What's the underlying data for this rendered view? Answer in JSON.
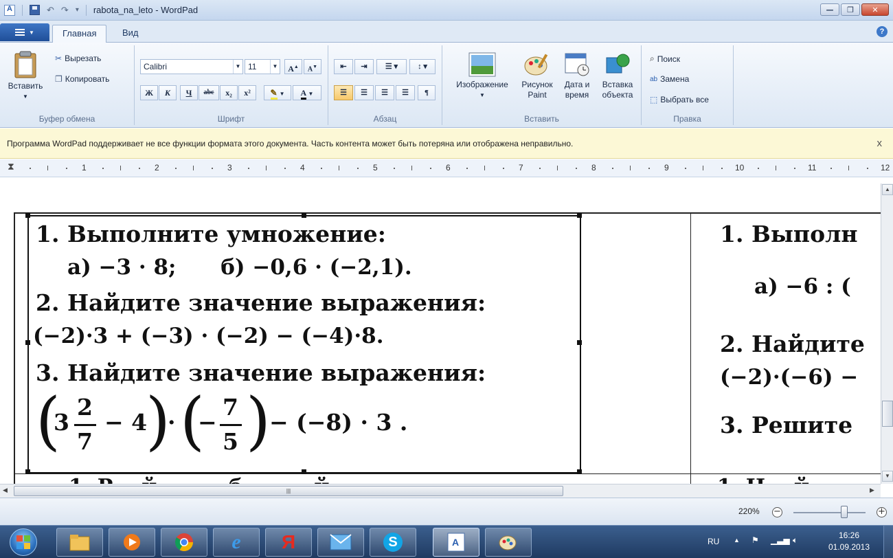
{
  "window": {
    "title": "rabota_na_leto - WordPad",
    "controls": {
      "minimize": "—",
      "maximize": "❐",
      "close": "✕"
    }
  },
  "ribbon": {
    "tabs": [
      {
        "label": "Главная",
        "active": true
      },
      {
        "label": "Вид",
        "active": false
      }
    ],
    "clipboard": {
      "paste": "Вставить",
      "cut": "Вырезать",
      "copy": "Копировать",
      "label": "Буфер обмена"
    },
    "font": {
      "family": "Calibri",
      "size": "11",
      "grow": "A",
      "shrink": "A",
      "bold": "Ж",
      "italic": "К",
      "underline": "Ч",
      "strike": "abc",
      "subscript": "x₂",
      "superscript": "x²",
      "highlight": "✎",
      "color": "A",
      "label": "Шрифт"
    },
    "paragraph": {
      "label": "Абзац"
    },
    "insert": {
      "picture": "Изображение",
      "paint": [
        "Рисунок",
        "Paint"
      ],
      "datetime": [
        "Дата и",
        "время"
      ],
      "object": [
        "Вставка",
        "объекта"
      ],
      "label": "Вставить"
    },
    "editing": {
      "find": "Поиск",
      "replace": "Замена",
      "select_all": "Выбрать все",
      "label": "Правка"
    }
  },
  "infobar": {
    "message": "Программа WordPad поддерживает не все функции формата этого документа. Часть контента может быть потеряна или отображена неправильно.",
    "close": "x"
  },
  "ruler": {
    "numbers": [
      "1",
      "2",
      "3",
      "4",
      "5",
      "6",
      "7",
      "8",
      "9",
      "10",
      "11",
      "12"
    ]
  },
  "document": {
    "left_column": {
      "task1_title": "1. Выполните умножение:",
      "task1_body": "а) −3 · 8;      б) −0,6 · (−2,1).",
      "task2_title": "2. Найдите значение выражения:",
      "task2_body": "(−2)·3 + (−3) · (−2) − (−4)·8.",
      "task3_title": "3. Найдите значение выражения:",
      "task3_whole": "3",
      "task3_frac1_num": "2",
      "task3_frac1_den": "7",
      "task3_minus4": "− 4",
      "task3_frac2_sign": "−",
      "task3_frac2_num": "7",
      "task3_frac2_den": "5",
      "task3_tail": "− (−8) · 3 .",
      "next_line": "1. Р    й          б          й"
    },
    "right_column": {
      "task1": "1. Выполн",
      "task1_body": "а) −6 : (",
      "task2": "2. Найдите",
      "task2_body": "(−2)·(−6) −",
      "task3": "3. Решите",
      "next_line": "1. Н    й"
    }
  },
  "statusbar": {
    "zoom": "220%",
    "zoom_level": 0.7
  },
  "taskbar": {
    "apps": [
      "Проводник",
      "Медиаплеер",
      "Chrome",
      "Internet Explorer",
      "Яндекс",
      "Почта",
      "Skype",
      "WordPad",
      "Paint"
    ],
    "language": "RU",
    "time": "16:26",
    "date": "01.09.2013"
  },
  "colors": {
    "accent": "#1f4e98",
    "infobar_bg": "#fcf8d6",
    "taskbar": "#2a4a78"
  }
}
